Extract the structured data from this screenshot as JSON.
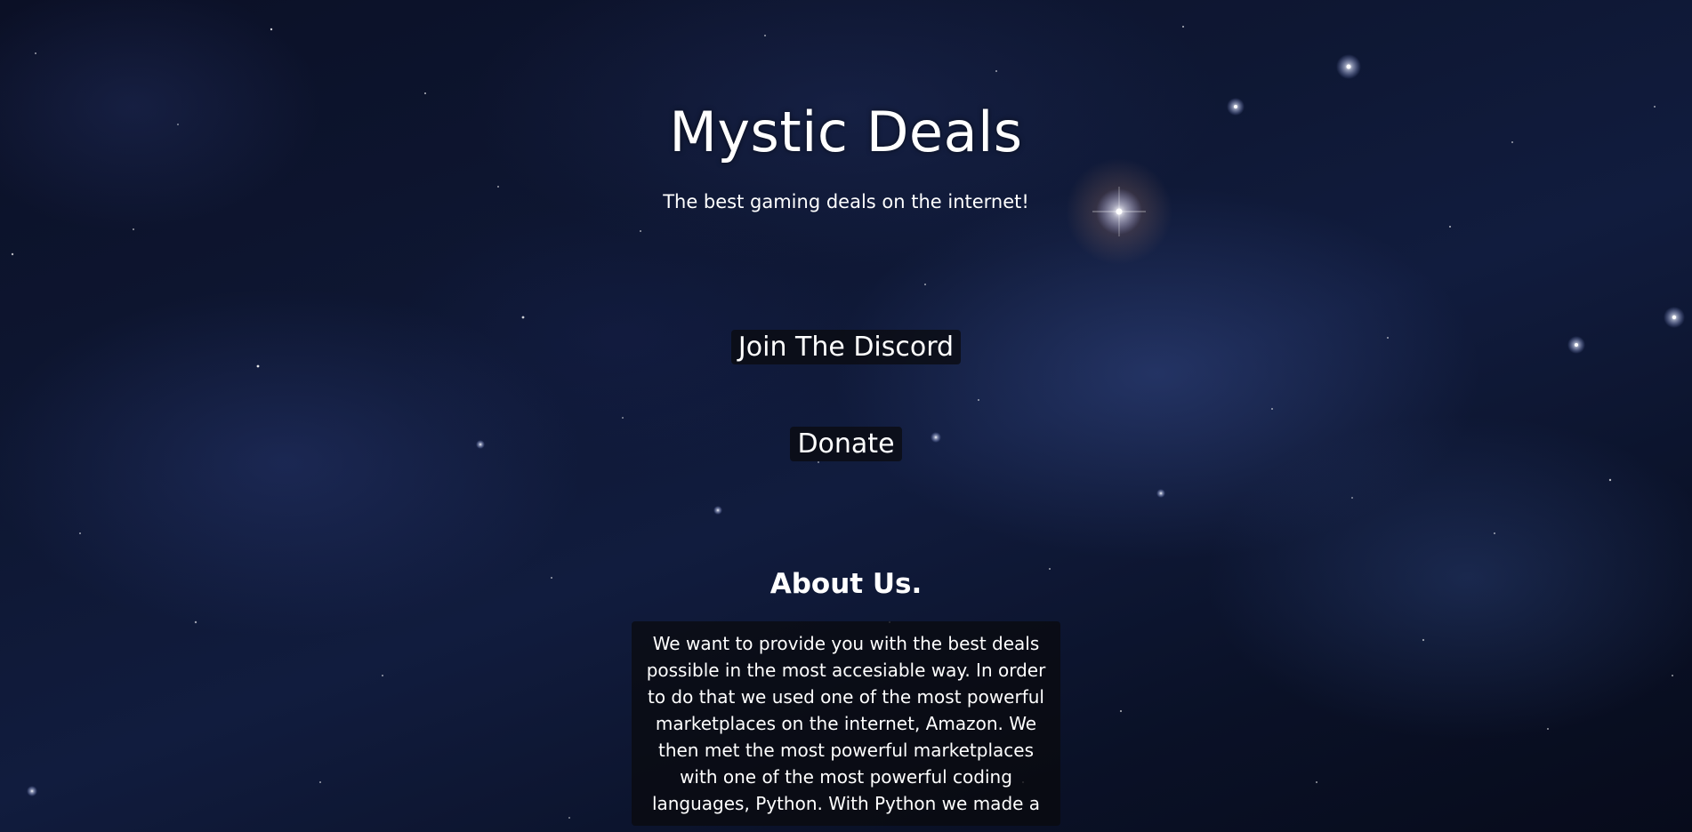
{
  "header": {
    "title": "Mystic Deals",
    "tagline": "The best gaming deals on the internet!"
  },
  "actions": {
    "discord_label": "Join The Discord",
    "donate_label": "Donate"
  },
  "about": {
    "heading": "About Us.",
    "body": "We want to provide you with the best deals possible in the most accesiable way. In order to do that we used one of the most powerful marketplaces on the internet, Amazon. We then met the most powerful marketplaces with one of the most powerful coding languages, Python. With Python we made a"
  },
  "colors": {
    "text": "#ffffff",
    "button_background": "#0a0a0c",
    "background_deep": "#070b1b",
    "background_nebula": "#465faa"
  }
}
